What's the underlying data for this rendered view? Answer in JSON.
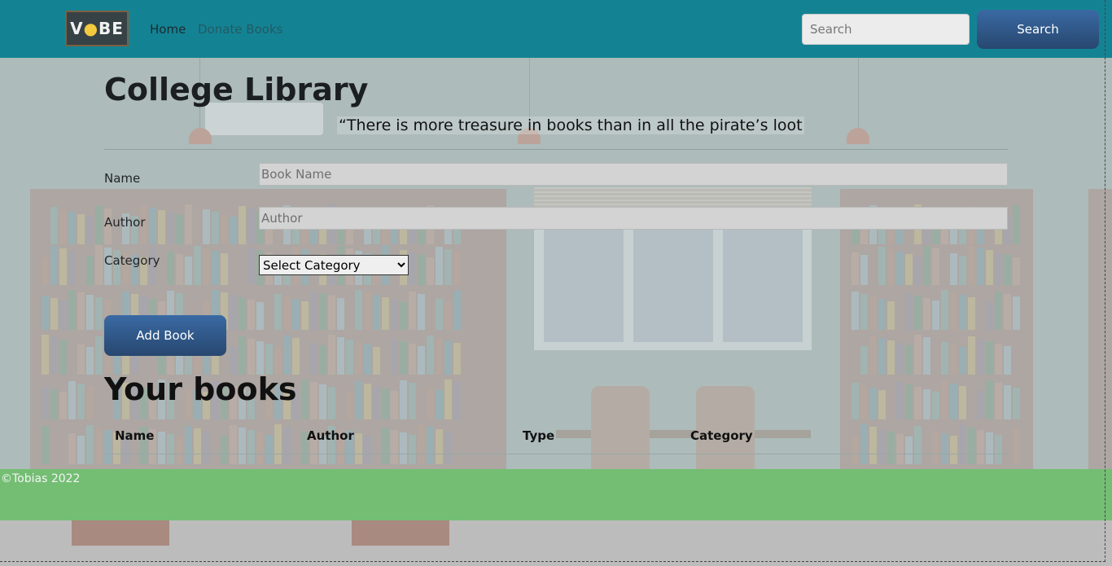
{
  "nav": {
    "logo_text": "VBE",
    "logo_bulb": "♨",
    "links": [
      "Home",
      "Donate Books"
    ],
    "search_placeholder": "Search",
    "search_button": "Search"
  },
  "page": {
    "title": "College Library",
    "quote": "“There is more treasure in books than in all the pirate’s loot"
  },
  "form": {
    "name_label": "Name",
    "name_placeholder": "Book Name",
    "author_label": "Author",
    "author_placeholder": "Author",
    "category_label": "Category",
    "category_selected": "Select Category",
    "add_button": "Add Book"
  },
  "books": {
    "title": "Your books",
    "columns": [
      "Name",
      "Author",
      "Type",
      "Category"
    ],
    "rows": []
  },
  "footer": {
    "text": "©Tobias 2022"
  },
  "colors": {
    "navbar": "#138394",
    "button": "#2f5a8e",
    "footer": "#74be73"
  }
}
